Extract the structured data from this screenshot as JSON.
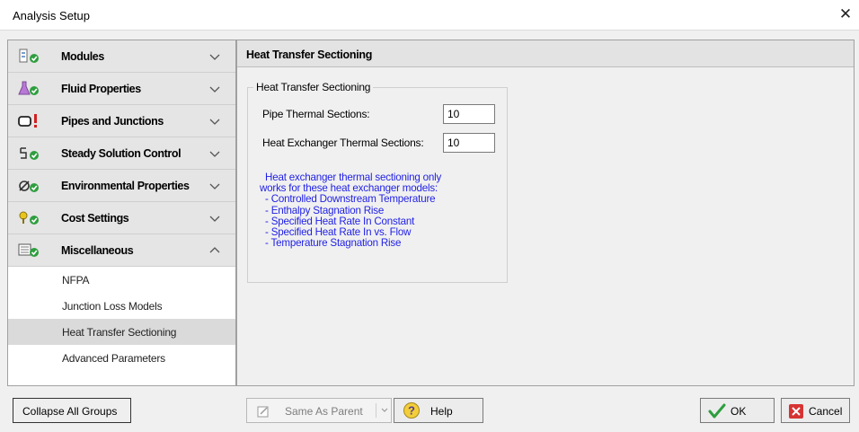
{
  "window": {
    "title": "Analysis Setup",
    "close_glyph": "✕"
  },
  "sidebar": {
    "groups": [
      {
        "label": "Modules",
        "icon": "modules-icon",
        "expanded": false
      },
      {
        "label": "Fluid Properties",
        "icon": "flask-icon",
        "expanded": false
      },
      {
        "label": "Pipes and Junctions",
        "icon": "pipe-warning-icon",
        "expanded": false
      },
      {
        "label": "Steady Solution Control",
        "icon": "solution-control-icon",
        "expanded": false
      },
      {
        "label": "Environmental Properties",
        "icon": "environment-icon",
        "expanded": false
      },
      {
        "label": "Cost Settings",
        "icon": "cost-icon",
        "expanded": false
      },
      {
        "label": "Miscellaneous",
        "icon": "miscellaneous-icon",
        "expanded": true
      }
    ],
    "misc_items": [
      {
        "label": "NFPA"
      },
      {
        "label": "Junction Loss Models"
      },
      {
        "label": "Heat Transfer Sectioning",
        "selected": true
      },
      {
        "label": "Advanced Parameters"
      }
    ]
  },
  "main": {
    "header": "Heat Transfer Sectioning",
    "group_title": "Heat Transfer Sectioning",
    "pipe_label": "Pipe Thermal Sections:",
    "pipe_value": "10",
    "hx_label": "Heat Exchanger Thermal Sections:",
    "hx_value": "10",
    "note_lines": [
      "  Heat exchanger thermal sectioning only",
      "works for these heat exchanger models:",
      "  - Controlled Downstream Temperature",
      "  - Enthalpy Stagnation Rise",
      "  - Specified Heat Rate In Constant",
      "  - Specified Heat Rate In vs. Flow",
      "  - Temperature Stagnation Rise"
    ]
  },
  "footer": {
    "collapse_all": "Collapse All Groups",
    "same_as_parent": "Same As Parent",
    "help": "Help",
    "ok": "OK",
    "cancel": "Cancel"
  },
  "colors": {
    "note_text": "#1f1fe6",
    "check_green": "#2e9e3e",
    "warning_red": "#d42020",
    "selected_row": "#dadada",
    "cancel_red": "#d63333"
  }
}
